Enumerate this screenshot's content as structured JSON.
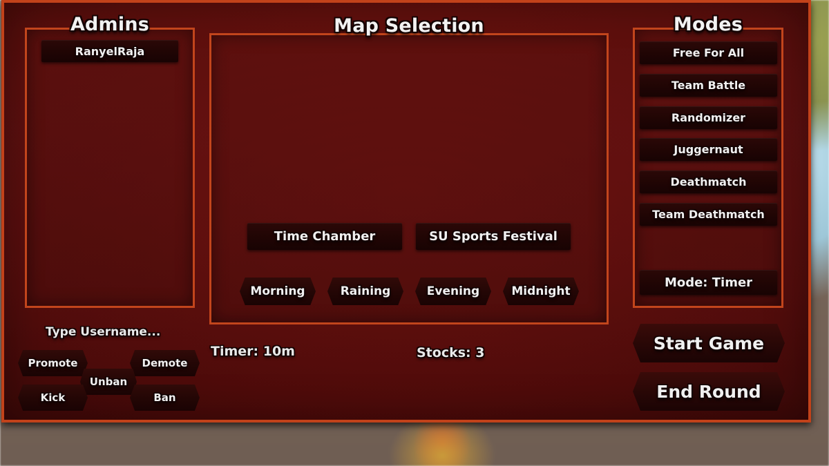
{
  "background": {
    "world_tint": "#756459",
    "frame_fill": "#5c1010",
    "frame_border": "#c2421a",
    "panel_border": "#c2451c",
    "button_fill": "#200504",
    "text_color": "#f0f0f0"
  },
  "admins": {
    "title": "Admins",
    "entries": [
      {
        "name": "RanyelRaja"
      }
    ],
    "username_input_placeholder": "Type Username...",
    "username_input_value": "",
    "actions": [
      {
        "id": "promote",
        "label": "Promote"
      },
      {
        "id": "demote",
        "label": "Demote"
      },
      {
        "id": "unban",
        "label": "Unban"
      },
      {
        "id": "kick",
        "label": "Kick"
      },
      {
        "id": "ban",
        "label": "Ban"
      }
    ]
  },
  "map_selection": {
    "title": "Map Selection",
    "maps": [
      {
        "id": "time-chamber",
        "label": "Time Chamber"
      },
      {
        "id": "su-sports-festival",
        "label": "SU Sports Festival"
      }
    ],
    "weather": [
      {
        "id": "morning",
        "label": "Morning"
      },
      {
        "id": "raining",
        "label": "Raining"
      },
      {
        "id": "evening",
        "label": "Evening"
      },
      {
        "id": "midnight",
        "label": "Midnight"
      }
    ],
    "timer_label": "Timer: 10m",
    "stocks_label": "Stocks: 3"
  },
  "modes": {
    "title": "Modes",
    "items": [
      {
        "id": "free-for-all",
        "label": "Free For All"
      },
      {
        "id": "team-battle",
        "label": "Team Battle"
      },
      {
        "id": "randomizer",
        "label": "Randomizer"
      },
      {
        "id": "juggernaut",
        "label": "Juggernaut"
      },
      {
        "id": "deathmatch",
        "label": "Deathmatch"
      },
      {
        "id": "team-deathmatch",
        "label": "Team Deathmatch"
      }
    ],
    "mode_toggle_label": "Mode: Timer"
  },
  "actions": {
    "start_game_label": "Start Game",
    "end_round_label": "End Round"
  }
}
